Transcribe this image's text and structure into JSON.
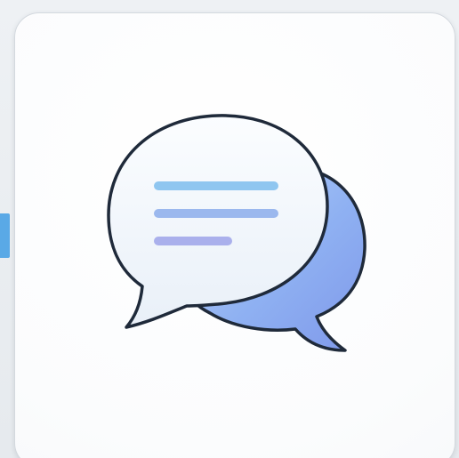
{
  "app_icon": {
    "icon": "chat-bubbles-icon",
    "colors": {
      "tile_background": "#ffffff",
      "tile_border": "#d3d8de",
      "front_bubble_fill": "#f3f7fb",
      "back_bubble_fill": "#8fb1f2",
      "outline": "#1f2a3a",
      "text_line_colors": [
        "#8fc6f0",
        "#9bb8ee",
        "#aab0ec"
      ],
      "edge_accent": "#5aa9e6"
    }
  }
}
